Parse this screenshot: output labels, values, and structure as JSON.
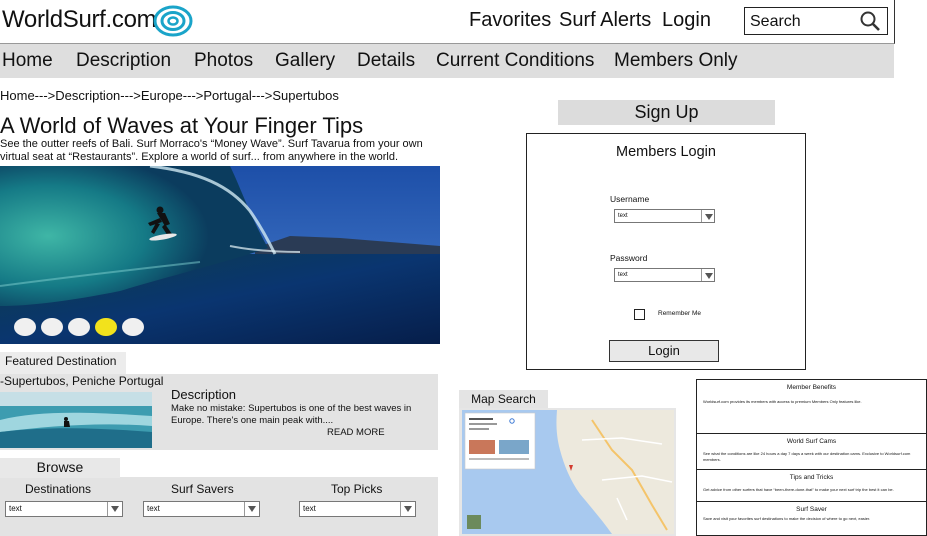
{
  "header": {
    "logo": "WorldSurf.com",
    "links": [
      "Favorites",
      "Surf Alerts",
      "Login"
    ],
    "search_placeholder": "Search"
  },
  "nav": {
    "items": [
      "Home",
      "Description",
      "Photos",
      "Gallery",
      "Details",
      "Current Conditions",
      "Members Only"
    ]
  },
  "breadcrumb": "Home--->Description--->Europe--->Portugal--->Supertubos",
  "hero": {
    "title": "A World of Waves at Your Finger Tips",
    "text": "See the outter reefs of Bali. Surf Morraco's “Money Wave”.  Surf Tavarua from your own virtual seat at “Restaurants”.  Explore a world of surf... from anywhere in the world.",
    "slides_total": 5,
    "active_slide": 4
  },
  "featured": {
    "tab": "Featured Destination",
    "name": "-Supertubos, Peniche Portugal",
    "desc_title": "Description",
    "desc": "Make no mistake: Supertubos is one of the best waves in Europe. There's one main peak with....",
    "read_more": "READ MORE"
  },
  "browse": {
    "tab": "Browse",
    "columns": [
      {
        "label": "Destinations",
        "value": "text"
      },
      {
        "label": "Surf Savers",
        "value": "text"
      },
      {
        "label": "Top Picks",
        "value": "text"
      }
    ]
  },
  "signup": "Sign Up",
  "login": {
    "title": "Members Login",
    "username_label": "Username",
    "username_value": "text",
    "password_label": "Password",
    "password_value": "text",
    "remember": "Remember Me",
    "button": "Login"
  },
  "map": {
    "tab": "Map Search"
  },
  "benefits": [
    {
      "title": "Member Benefits",
      "text": "Worldsurf.com provides its members with access to premium Members Only features like."
    },
    {
      "title": "World Surf Cams",
      "text": "See what the conditions are like 24 hours a day 7 days a week with our destination cams. Exclusive to Worldsurf.com members."
    },
    {
      "title": "Tips and Tricks",
      "text": "Get advice from other surfers that have “been-there-done-that” to make your next surf trip the best it can be."
    },
    {
      "title": "Surf Saver",
      "text": "Save and visit your favorites surf destinations to make the decision of where to go next, easier."
    }
  ],
  "colors": {
    "nav_bg": "#dedede",
    "active_dot": "#f2e21c",
    "logo_swirl": "#1aa4c9"
  }
}
